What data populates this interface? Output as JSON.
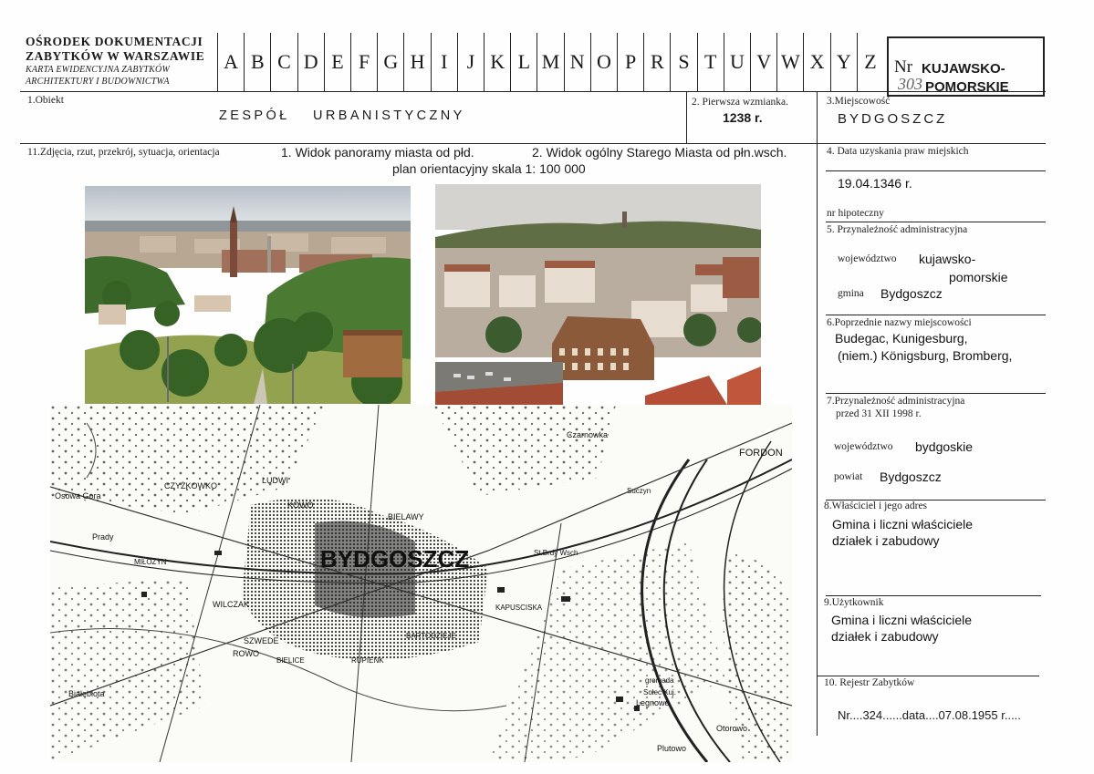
{
  "header": {
    "org_line1": "OŚRODEK DOKUMENTACJI",
    "org_line2": "ZABYTKÓW W WARSZAWIE",
    "org_line3": "KARTA EWIDENCYJNA ZABYTKÓW",
    "org_line4": "ARCHITEKTURY I BUDOWNICTWA",
    "letters": [
      "A",
      "B",
      "C",
      "D",
      "E",
      "F",
      "G",
      "H",
      "I",
      "J",
      "K",
      "L",
      "M",
      "N",
      "O",
      "P",
      "R",
      "S",
      "T",
      "U",
      "V",
      "W",
      "X",
      "Y",
      "Z"
    ],
    "nr_label": "Nr",
    "nr_number": "303",
    "region_line1": "KUJAWSKO-",
    "region_line2": "POMORSKIE"
  },
  "row1": {
    "obiekt_label": "1.Obiekt",
    "obiekt_value": "ZESPÓŁ URBANISTYCZNY",
    "wzmianka_label": "2. Pierwsza wzmianka.",
    "wzmianka_value": "1238 r.",
    "miejscowosc_label": "3.Miejscowość",
    "miejscowosc_value": "BYDGOSZCZ"
  },
  "photos_section": {
    "label": "11.Zdjęcia, rzut, przekrój, sytuacja, orientacja",
    "caption1": "1. Widok panoramy miasta od płd.",
    "caption2": "2. Widok ogólny Starego Miasta od płn.wsch.",
    "caption3": "plan orientacyjny skala 1: 100 000"
  },
  "map_labels": {
    "city": "BYDGOSZCZ",
    "czyzkowko": "CZYŻKOWKO",
    "ludwi": "LUDWI",
    "kowo": "KOWO",
    "bielawy": "BIELAWY",
    "czarnowka": "Czarnowka",
    "fordon": "FORDON",
    "osowa_gora": "Osowa Gora",
    "prady": "Prady",
    "milozyn": "MIŁOŻYN",
    "wilczak": "WILCZAK",
    "szwede": "SZWEDE",
    "rowo": "ROWO",
    "bielice": "BIELICE",
    "rupienk": "RUPIENK",
    "bialeblota": "Białebłota",
    "legnowo": "Legnowo",
    "otorowo": "Otorowo",
    "plutowo": "Plutowo",
    "brdy": "St.Brdy Wsch",
    "kapusciska": "KAPUSCISKA",
    "suczyn": "Suczyn",
    "gromada": "gromada",
    "solec": "Solec Kuj.",
    "bartodzieje": "BARTODZIEJE"
  },
  "right": {
    "f4_label": "4. Data uzyskania praw miejskich",
    "f4_value": "19.04.1346 r.",
    "hipoteczny": "nr hipoteczny",
    "f5_label": "5. Przynależność administracyjna",
    "f5_woj_label": "województwo",
    "f5_woj_value1": "kujawsko-",
    "f5_woj_value2": "pomorskie",
    "f5_gmina_label": "gmina",
    "f5_gmina_value": "Bydgoszcz",
    "f6_label": "6.Poprzednie nazwy miejscowości",
    "f6_value1": "Budegac, Kunigesburg,",
    "f6_value2": "(niem.) Königsburg, Bromberg,",
    "f7_label": "7.Przynależność administracyjna",
    "f7_label2": "przed 31 XII 1998 r.",
    "f7_woj_label": "województwo",
    "f7_woj_value": "bydgoskie",
    "f7_powiat_label": "powiat",
    "f7_powiat_value": "Bydgoszcz",
    "f8_label": "8.Właściciel i jego adres",
    "f8_value1": "Gmina i liczni właściciele",
    "f8_value2": "działek i zabudowy",
    "f9_label": "9.Użytkownik",
    "f9_value1": "Gmina i liczni właściciele",
    "f9_value2": "działek i zabudowy",
    "f10_label": "10. Rejestr Zabytków",
    "f10_value": "Nr....324......data....07.08.1955 r....."
  }
}
